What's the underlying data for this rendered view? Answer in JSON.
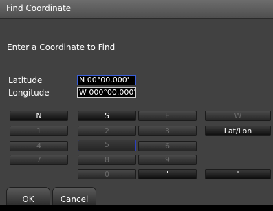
{
  "window": {
    "title": "Find Coordinate"
  },
  "prompt": "Enter a Coordinate to Find",
  "fields": {
    "latitude_label": "Latitude",
    "latitude_value": "N 00°00.000'",
    "longitude_label": "Longitude",
    "longitude_value": "W 000°00.000'"
  },
  "keypad": {
    "n": "N",
    "s": "S",
    "e": "E",
    "w": "W",
    "k1": "1",
    "k2": "2",
    "k3": "3",
    "latlon": "Lat/Lon",
    "k4": "4",
    "k5": "5",
    "k6": "6",
    "k7": "7",
    "k8": "8",
    "k9": "9",
    "k0": "0",
    "dot": "'",
    "apos": "'"
  },
  "buttons": {
    "ok": "OK",
    "cancel": "Cancel"
  }
}
